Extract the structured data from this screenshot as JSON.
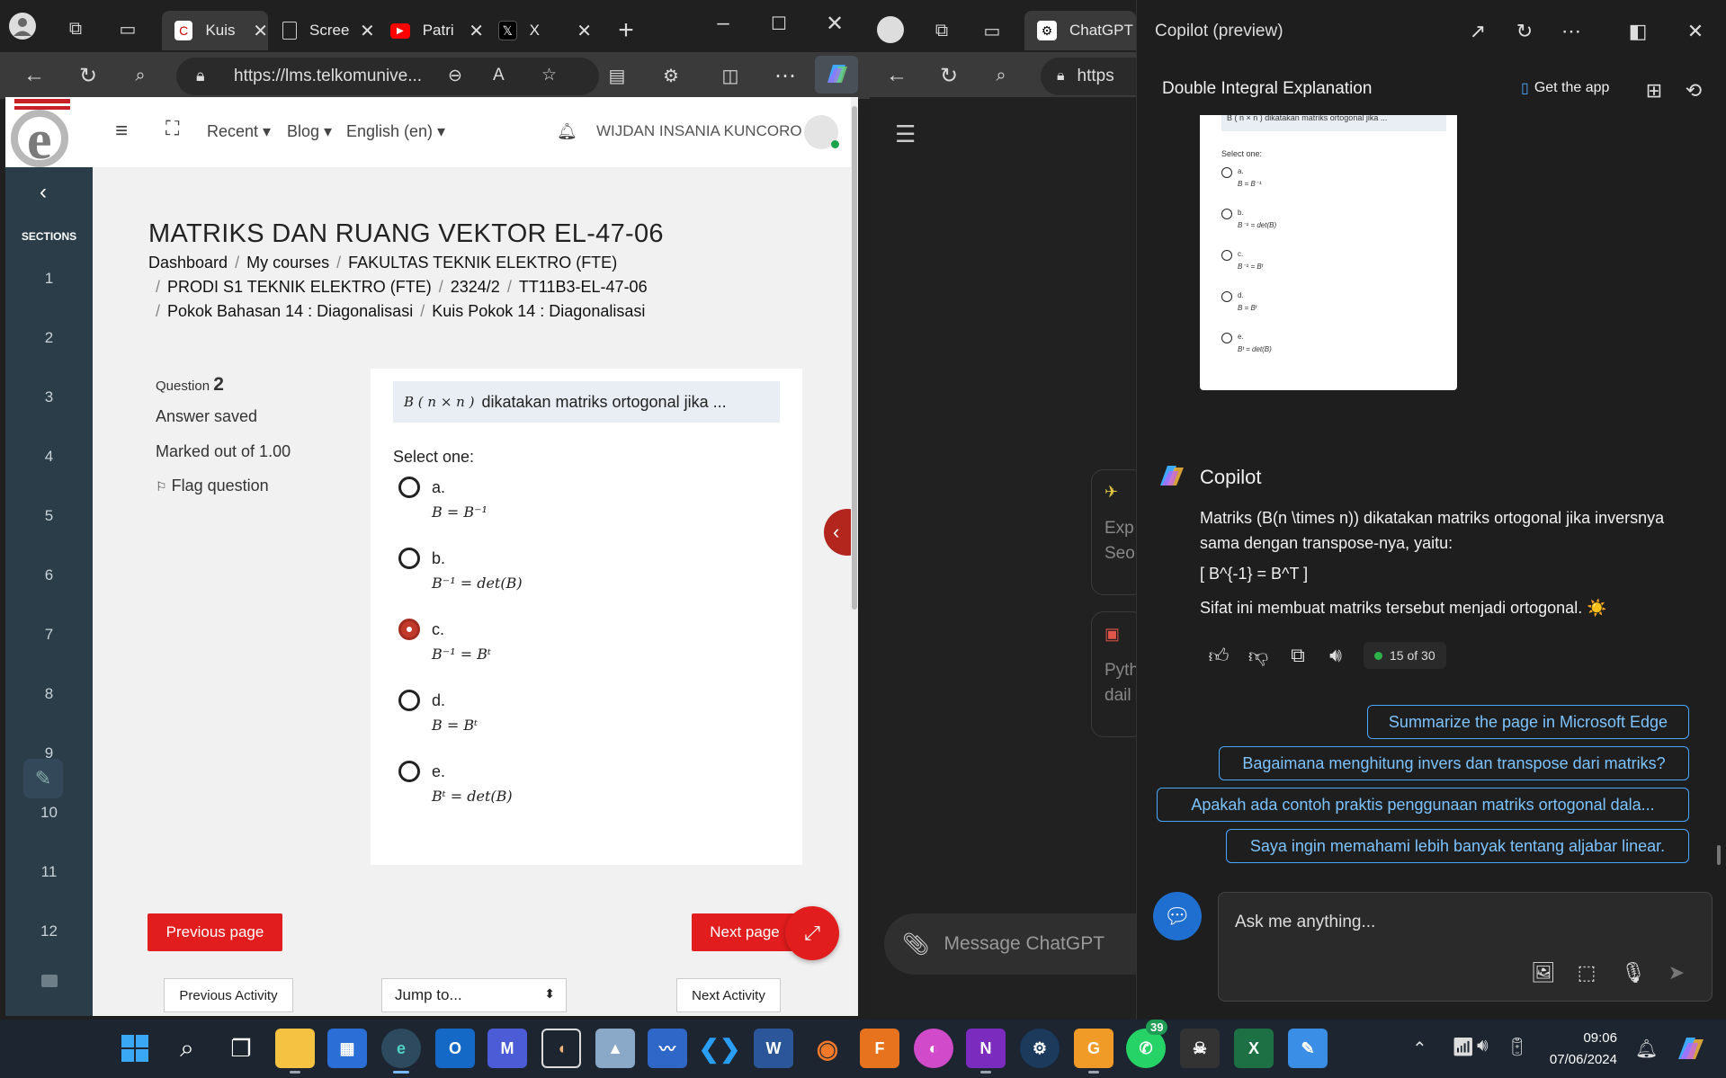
{
  "left_browser": {
    "tabs": [
      {
        "label": "Kuis",
        "icon": "lms-favicon"
      },
      {
        "label": "Scree",
        "icon": "page-icon"
      },
      {
        "label": "Patri",
        "icon": "youtube-icon"
      },
      {
        "label": "X",
        "icon": "x-icon"
      }
    ],
    "url": "https://lms.telkomunive..."
  },
  "lms": {
    "header": {
      "recent": "Recent",
      "blog": "Blog",
      "language": "English (en)",
      "user_name": "WIJDAN INSANIA KUNCORO"
    },
    "sidebar": {
      "title": "SECTIONS",
      "sections": [
        "1",
        "2",
        "3",
        "4",
        "5",
        "6",
        "7",
        "8",
        "9",
        "10",
        "11",
        "12"
      ]
    },
    "course_title": "MATRIKS DAN RUANG VEKTOR EL-47-06",
    "breadcrumb": {
      "dashboard": "Dashboard",
      "my_courses": "My courses",
      "faculty": "FAKULTAS TEKNIK ELEKTRO (FTE)",
      "program": "PRODI S1 TEKNIK ELEKTRO (FTE)",
      "term": "2324/2",
      "class": "TT11B3-EL-47-06",
      "topic": "Pokok Bahasan 14 : Diagonalisasi",
      "quiz": "Kuis Pokok 14 : Diagonalisasi"
    },
    "question": {
      "label": "Question",
      "number": "2",
      "status": "Answer saved",
      "marks": "Marked out of 1.00",
      "flag": "Flag question",
      "text_math": "B ( n × n )",
      "text": "dikatakan matriks ortogonal jika ...",
      "select_one": "Select one:",
      "options": [
        {
          "letter": "a.",
          "math": "B = B⁻¹",
          "selected": false
        },
        {
          "letter": "b.",
          "math": "B⁻¹ = det(B)",
          "selected": false
        },
        {
          "letter": "c.",
          "math": "B⁻¹ = Bᵗ",
          "selected": true
        },
        {
          "letter": "d.",
          "math": "B = Bᵗ",
          "selected": false
        },
        {
          "letter": "e.",
          "math": "Bᵗ = det(B)",
          "selected": false
        }
      ]
    },
    "nav": {
      "previous_page": "Previous page",
      "next_page": "Next page",
      "previous_activity": "Previous Activity",
      "jump_to": "Jump to...",
      "next_activity": "Next Activity"
    }
  },
  "mid_browser": {
    "tab": "ChatGPT",
    "url": "https",
    "card1": [
      "Exp",
      "Seo"
    ],
    "card2": [
      "Pyth",
      "dail"
    ],
    "message_placeholder": "Message ChatGPT"
  },
  "copilot": {
    "window_title": "Copilot (preview)",
    "conversation_title": "Double Integral Explanation",
    "get_app": "Get the app",
    "thumb": {
      "header": "B ( n × n ) dikatakan matriks ortogonal jika ...",
      "select_one": "Select one:",
      "options": [
        {
          "letter": "a.",
          "math": "B = B⁻¹"
        },
        {
          "letter": "b.",
          "math": "B⁻¹ = det(B)"
        },
        {
          "letter": "c.",
          "math": "B⁻¹ = Bᵗ"
        },
        {
          "letter": "d.",
          "math": "B = Bᵗ"
        },
        {
          "letter": "e.",
          "math": "Bᵗ = det(B)"
        }
      ]
    },
    "assistant_name": "Copilot",
    "response": {
      "p1": "Matriks (B(n \\times n)) dikatakan matriks ortogonal jika inversnya sama dengan transpose-nya, yaitu:",
      "p2": "[ B^{-1} = B^T ]",
      "p3": "Sifat ini membuat matriks tersebut menjadi ortogonal. ☀️"
    },
    "counter": "15 of 30",
    "suggestions": [
      "Summarize the page in Microsoft Edge",
      "Bagaimana menghitung invers dan transpose dari matriks?",
      "Apakah ada contoh praktis penggunaan matriks ortogonal dala...",
      "Saya ingin memahami lebih banyak tentang aljabar linear."
    ],
    "input_placeholder": "Ask me anything..."
  },
  "taskbar": {
    "whatsapp_badge": "39",
    "time": "09:06",
    "date": "07/06/2024"
  },
  "colors": {
    "lms_red": "#e11d1d",
    "lms_sidebar": "#2b3d48",
    "copilot_link": "#4aa8ff",
    "radio_selected": "#c0392b"
  }
}
